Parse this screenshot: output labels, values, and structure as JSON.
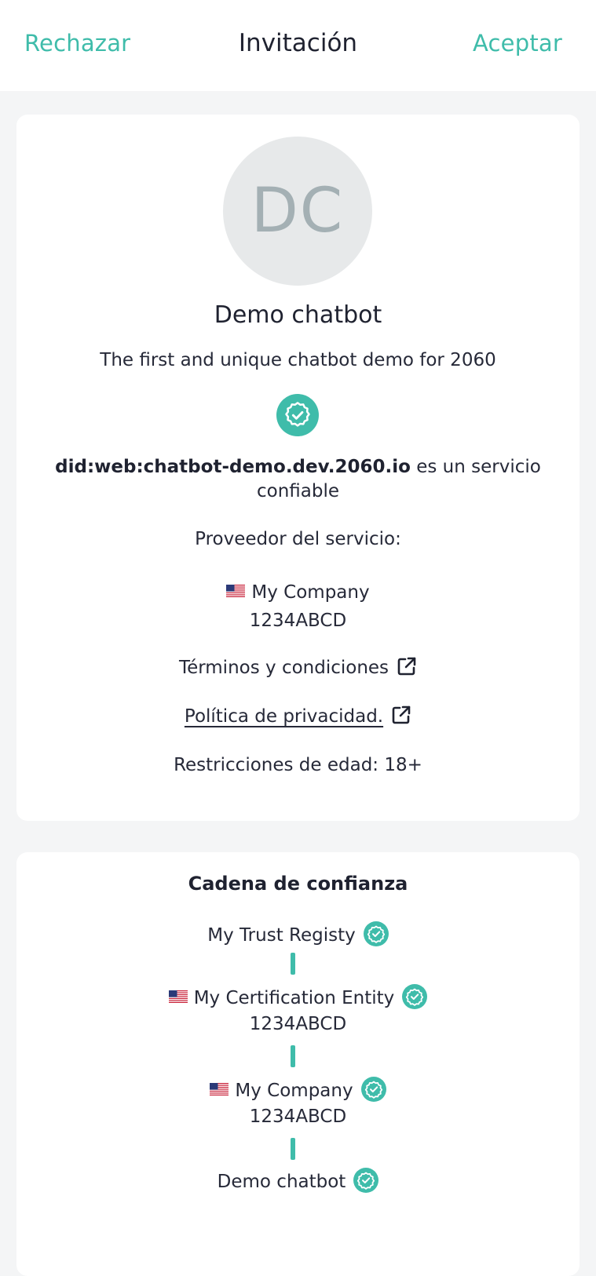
{
  "header": {
    "reject_label": "Rechazar",
    "title": "Invitación",
    "accept_label": "Aceptar"
  },
  "service": {
    "avatar_initials": "DC",
    "name": "Demo chatbot",
    "description": "The first and unique chatbot demo for 2060",
    "verified_icon": "verified-badge-icon",
    "did": "did:web:chatbot-demo.dev.2060.io",
    "trust_suffix": " es un servicio",
    "trust_suffix_line2": "confiable",
    "provider_label": "Proveedor del servicio:",
    "provider_flag": "us-flag-icon",
    "provider_name": "My Company",
    "provider_id": "1234ABCD",
    "terms_label": "Términos y condiciones",
    "privacy_label": "Política de privacidad.",
    "age_restriction": "Restricciones de edad: 18+"
  },
  "trust_chain": {
    "title": "Cadena de confianza",
    "items": [
      {
        "name": "My Trust Registy",
        "flag": "",
        "id": ""
      },
      {
        "name": "My Certification Entity",
        "flag": "us-flag-icon",
        "id": "1234ABCD"
      },
      {
        "name": "My Company",
        "flag": "us-flag-icon",
        "id": "1234ABCD"
      },
      {
        "name": "Demo chatbot",
        "flag": "",
        "id": ""
      }
    ]
  },
  "colors": {
    "accent": "#3fbcaa",
    "text": "#1f2230",
    "avatar_bg": "#e7e9ea",
    "avatar_text": "#a4b0b4",
    "page_bg": "#f4f5f6"
  }
}
